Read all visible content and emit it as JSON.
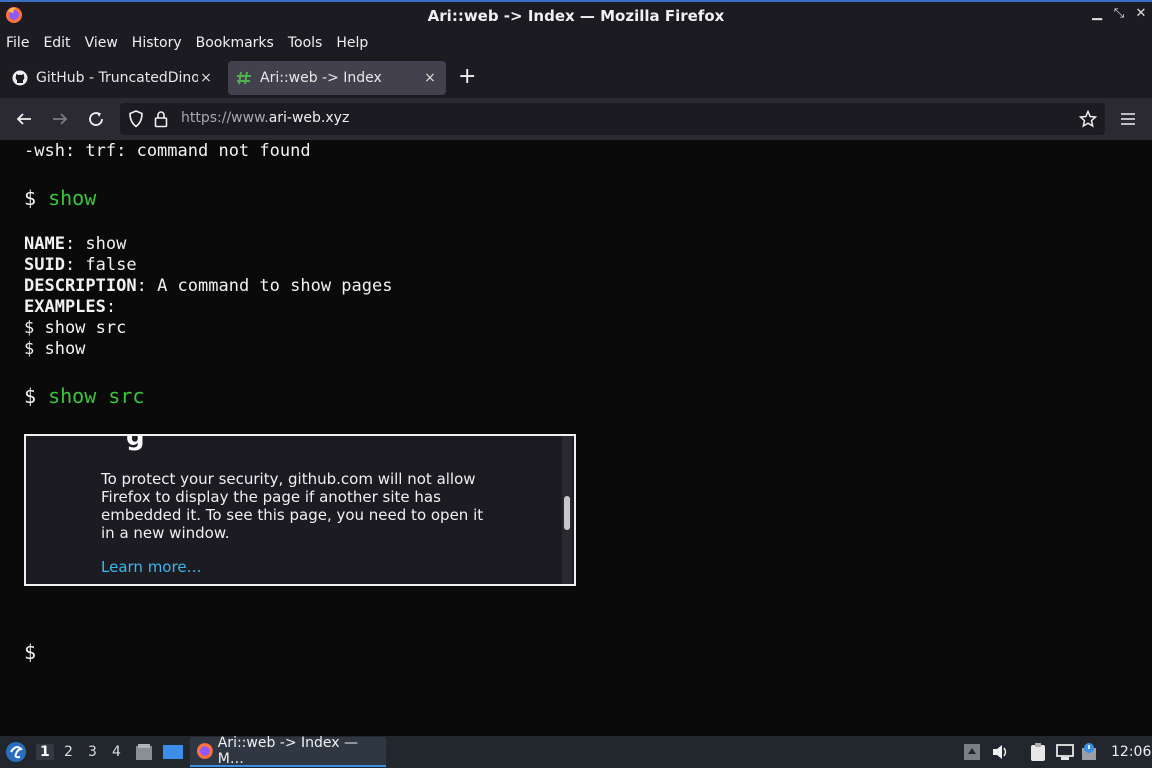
{
  "window": {
    "title": "Ari::web -> Index — Mozilla Firefox"
  },
  "menu": [
    "File",
    "Edit",
    "View",
    "History",
    "Bookmarks",
    "Tools",
    "Help"
  ],
  "tabs": [
    {
      "label": "GitHub - TruncatedDinosour",
      "close": "×"
    },
    {
      "label": "Ari::web -> Index",
      "close": "×"
    }
  ],
  "newtab": "+",
  "url": {
    "scheme": "https://www.",
    "host": "ari-web.xyz"
  },
  "terminal": {
    "error_line": "-wsh: trf: command not found",
    "prompt": "$",
    "cmd1": "show",
    "name_key": "NAME",
    "name_val": ": show",
    "suid_key": "SUID",
    "suid_val": ": false",
    "desc_key": "DESCRIPTION",
    "desc_val": ": A command to show pages",
    "examples_key": "EXAMPLES",
    "examples_colon": ":",
    "example1": "$ show src",
    "example2": "$ show",
    "cmd2": "show src",
    "final_prompt": "$"
  },
  "iframe": {
    "message": "To protect your security, github.com will not allow Firefox to display the page if another site has embedded it. To see this page, you need to open it in a new window.",
    "link": "Learn more…"
  },
  "taskbar": {
    "workspaces": [
      "1",
      "2",
      "3",
      "4"
    ],
    "task_label": "Ari::web -> Index — M…",
    "clock": "12:06"
  },
  "colors": {
    "prompt_green": "#3cc43c",
    "link_blue": "#3ab8f0",
    "chrome_bg": "#1c1b22"
  }
}
